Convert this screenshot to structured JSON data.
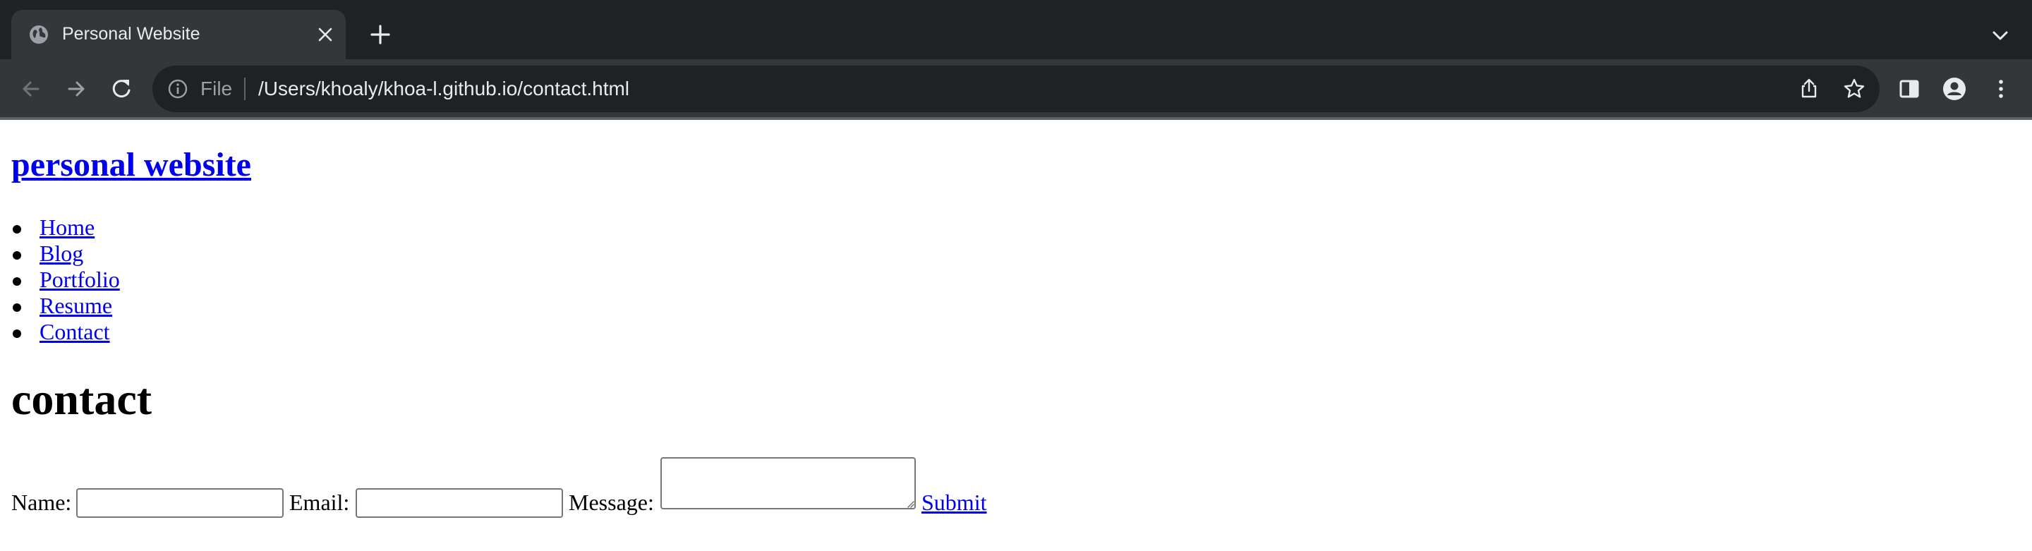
{
  "browser": {
    "tab": {
      "title": "Personal Website",
      "favicon": "globe-icon"
    },
    "address_bar": {
      "scheme_label": "File",
      "url": "/Users/khoaly/khoa-l.github.io/contact.html"
    },
    "icons": {
      "back": "arrow-left-icon",
      "forward": "arrow-right-icon",
      "reload": "reload-icon",
      "info": "info-icon",
      "share": "share-icon",
      "bookmark": "star-icon",
      "side_panel": "side-panel-icon",
      "profile": "profile-icon",
      "menu": "kebab-menu-icon",
      "new_tab": "plus-icon",
      "tab_search": "chevron-down-icon",
      "close_tab": "close-icon"
    },
    "colors": {
      "tabstrip": "#202124",
      "toolbar": "#35363a",
      "text": "#e8eaed",
      "muted": "#9aa0a6"
    }
  },
  "page": {
    "site_title": "personal website",
    "nav": [
      {
        "label": "Home"
      },
      {
        "label": "Blog"
      },
      {
        "label": "Portfolio"
      },
      {
        "label": "Resume"
      },
      {
        "label": "Contact"
      }
    ],
    "heading": "contact",
    "form": {
      "name_label": "Name:",
      "name_value": "",
      "email_label": "Email:",
      "email_value": "",
      "message_label": "Message:",
      "message_value": "",
      "submit_label": "Submit"
    },
    "colors": {
      "link": "#0000ee",
      "text": "#000000",
      "background": "#ffffff"
    }
  }
}
